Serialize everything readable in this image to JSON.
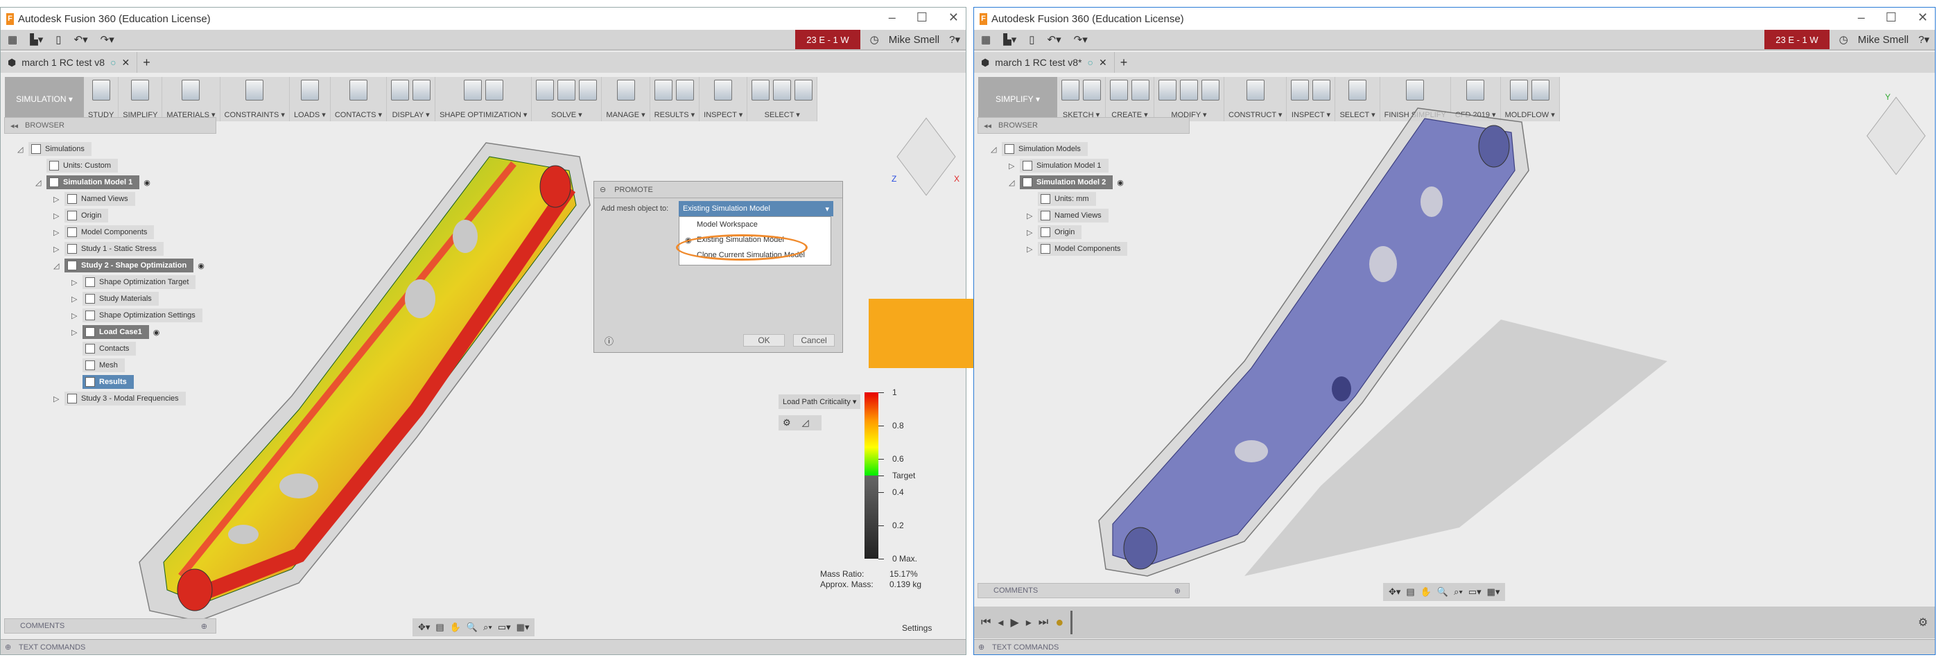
{
  "left": {
    "title": "Autodesk Fusion 360 (Education License)",
    "badge": "23 E - 1 W",
    "user": "Mike Smell",
    "doc_tab": "march 1 RC test v8",
    "workspace": "SIMULATION",
    "ribbon": [
      {
        "label": "STUDY",
        "n": 1
      },
      {
        "label": "SIMPLIFY",
        "n": 1
      },
      {
        "label": "MATERIALS ▾",
        "n": 1
      },
      {
        "label": "CONSTRAINTS ▾",
        "n": 1
      },
      {
        "label": "LOADS ▾",
        "n": 1
      },
      {
        "label": "CONTACTS ▾",
        "n": 1
      },
      {
        "label": "DISPLAY ▾",
        "n": 2
      },
      {
        "label": "SHAPE OPTIMIZATION ▾",
        "n": 2
      },
      {
        "label": "SOLVE ▾",
        "n": 3
      },
      {
        "label": "MANAGE ▾",
        "n": 1
      },
      {
        "label": "RESULTS ▾",
        "n": 2
      },
      {
        "label": "INSPECT ▾",
        "n": 1
      },
      {
        "label": "SELECT ▾",
        "n": 3
      }
    ],
    "browser_label": "BROWSER",
    "tree": [
      {
        "label": "Simulations",
        "level": 0,
        "exp": "◿"
      },
      {
        "label": "Units: Custom",
        "level": 1,
        "exp": ""
      },
      {
        "label": "Simulation Model 1",
        "level": 1,
        "exp": "◿",
        "sel": true
      },
      {
        "label": "Named Views",
        "level": 2,
        "exp": "▷"
      },
      {
        "label": "Origin",
        "level": 2,
        "exp": "▷"
      },
      {
        "label": "Model Components",
        "level": 2,
        "exp": "▷"
      },
      {
        "label": "Study 1 - Static Stress",
        "level": 2,
        "exp": "▷"
      },
      {
        "label": "Study 2 - Shape Optimization",
        "level": 2,
        "exp": "◿",
        "sel": true
      },
      {
        "label": "Shape Optimization Target",
        "level": 3,
        "exp": "▷"
      },
      {
        "label": "Study Materials",
        "level": 3,
        "exp": "▷"
      },
      {
        "label": "Shape Optimization Settings",
        "level": 3,
        "exp": "▷"
      },
      {
        "label": "Load Case1",
        "level": 3,
        "exp": "▷",
        "sel": true
      },
      {
        "label": "Contacts",
        "level": 3,
        "exp": ""
      },
      {
        "label": "Mesh",
        "level": 3,
        "exp": ""
      },
      {
        "label": "Results",
        "level": 3,
        "exp": "",
        "res": true
      },
      {
        "label": "Study 3 - Modal Frequencies",
        "level": 2,
        "exp": "▷"
      }
    ],
    "dialog": {
      "title": "PROMOTE",
      "field_label": "Add mesh object to:",
      "selected": "Existing Simulation Model",
      "options": [
        "Model Workspace",
        "Existing Simulation Model",
        "Clone Current Simulation Model"
      ],
      "ok": "OK",
      "cancel": "Cancel"
    },
    "legend": {
      "dropdown": "Load Path Criticality ▾",
      "ticks": [
        "1",
        "0.8",
        "0.6",
        "Target",
        "0.4",
        "0.2",
        "0 Max."
      ],
      "mass_ratio_label": "Mass Ratio:",
      "mass_ratio": "15.17%",
      "approx_mass_label": "Approx. Mass:",
      "approx_mass": "0.139 kg"
    },
    "comments": "COMMENTS",
    "settings": "Settings",
    "text_commands": "TEXT COMMANDS"
  },
  "right": {
    "title": "Autodesk Fusion 360 (Education License)",
    "badge": "23 E - 1 W",
    "user": "Mike Smell",
    "doc_tab": "march 1 RC test v8*",
    "workspace": "SIMPLIFY",
    "ribbon": [
      {
        "label": "SKETCH ▾",
        "n": 2
      },
      {
        "label": "CREATE ▾",
        "n": 2
      },
      {
        "label": "MODIFY ▾",
        "n": 3
      },
      {
        "label": "CONSTRUCT ▾",
        "n": 1
      },
      {
        "label": "INSPECT ▾",
        "n": 2
      },
      {
        "label": "SELECT ▾",
        "n": 1
      },
      {
        "label": "FINISH SIMPLIFY",
        "n": 1
      },
      {
        "label": "CFD 2019 ▾",
        "n": 1
      },
      {
        "label": "MOLDFLOW ▾",
        "n": 2
      }
    ],
    "browser_label": "BROWSER",
    "tree": [
      {
        "label": "Simulation Models",
        "level": 0,
        "exp": "◿"
      },
      {
        "label": "Simulation Model 1",
        "level": 1,
        "exp": "▷"
      },
      {
        "label": "Simulation Model 2",
        "level": 1,
        "exp": "◿",
        "sel": true
      },
      {
        "label": "Units: mm",
        "level": 2,
        "exp": ""
      },
      {
        "label": "Named Views",
        "level": 2,
        "exp": "▷"
      },
      {
        "label": "Origin",
        "level": 2,
        "exp": "▷"
      },
      {
        "label": "Model Components",
        "level": 2,
        "exp": "▷"
      }
    ],
    "comments": "COMMENTS",
    "text_commands": "TEXT COMMANDS"
  },
  "colors": {
    "badge": "#a51f26",
    "selection": "#5a88b5",
    "arrow": "#f7a81b",
    "mesh": "#7a7fc0"
  }
}
